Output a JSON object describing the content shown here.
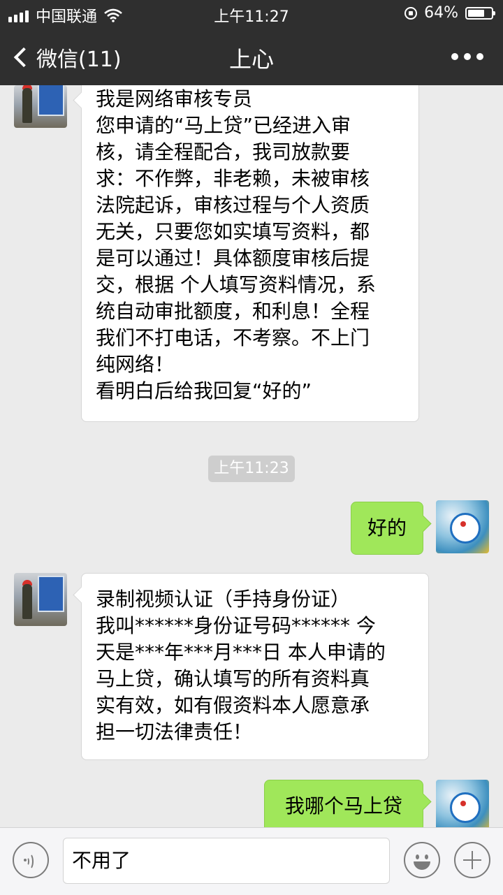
{
  "status_bar": {
    "carrier": "中国联通",
    "time": "上午11:27",
    "battery": "64%",
    "battery_level": 0.64,
    "icons": [
      "signal-icon",
      "wifi-icon",
      "rotation-lock-icon",
      "battery-icon"
    ]
  },
  "nav": {
    "back_label": "微信(11)",
    "title": "上心",
    "icons": [
      "back-chevron-icon",
      "more-icon"
    ]
  },
  "messages": [
    {
      "side": "left",
      "lines": [
        "我是网络审核专员",
        "您申请的“马上贷”已经进入审",
        "核，请全程配合，我司放款要",
        "求：不作弊，非老赖，未被审核",
        "法院起诉，审核过程与个人资质",
        "无关，只要您如实填写资料，都",
        "是可以通过！具体额度审核后提",
        "交，根据 个人填写资料情况，系",
        "统自动审批额度，和利息！全程",
        "我们不打电话，不考察。不上门",
        "纯网络！",
        "看明白后给我回复“好的”"
      ]
    },
    {
      "side": "timestamp",
      "text": "上午11:23"
    },
    {
      "side": "right",
      "lines": [
        "好的"
      ]
    },
    {
      "side": "left",
      "lines": [
        "录制视频认证（手持身份证）",
        "我叫******身份证号码******  今",
        "天是***年***月***日   本人申请的",
        "马上贷，确认填写的所有资料真",
        "实有效，如有假资料本人愿意承",
        "担一切法律责任！"
      ]
    },
    {
      "side": "right",
      "lines": [
        "我哪个马上贷"
      ]
    }
  ],
  "input_bar": {
    "value": "不用了",
    "icons": [
      "voice-icon",
      "emoji-icon",
      "plus-icon"
    ]
  },
  "colors": {
    "header_bg": "#2f2f2f",
    "chat_bg": "#ebebeb",
    "sent_bubble": "#a0e75a",
    "received_bubble": "#ffffff"
  }
}
